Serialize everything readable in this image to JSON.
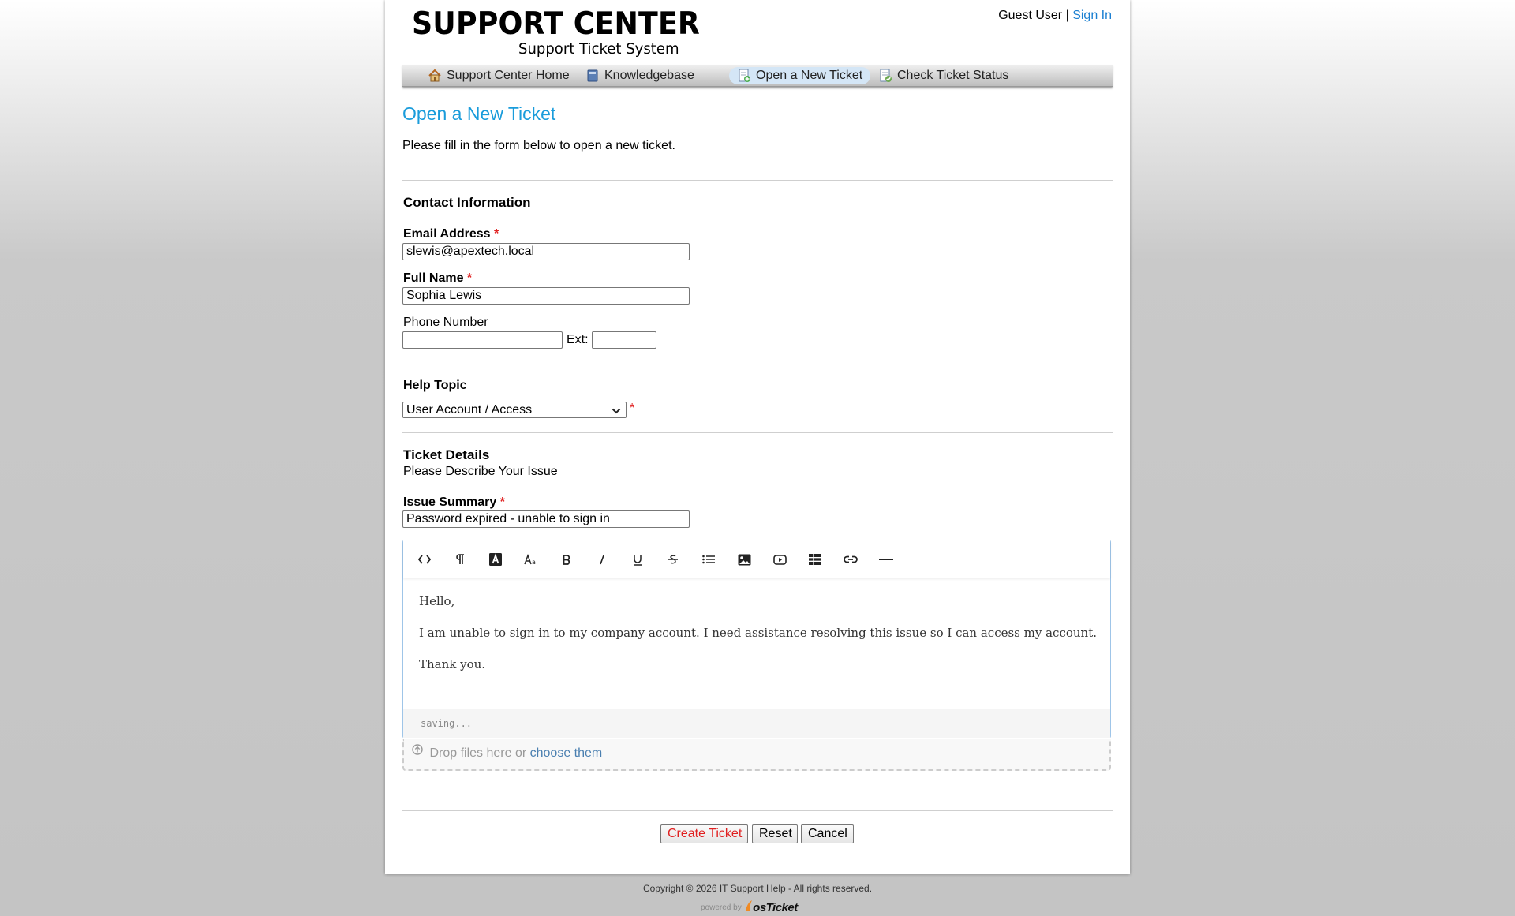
{
  "header": {
    "logo_title": "SUPPORT CENTER",
    "logo_subtitle": "Support Ticket System",
    "user_label": "Guest User",
    "separator": "|",
    "sign_in": "Sign In"
  },
  "nav": {
    "items": [
      {
        "label": "Support Center Home",
        "icon": "home-icon"
      },
      {
        "label": "Knowledgebase",
        "icon": "book-icon"
      },
      {
        "label": "Open a New Ticket",
        "icon": "new-ticket-icon",
        "active": true
      },
      {
        "label": "Check Ticket Status",
        "icon": "ticket-status-icon"
      }
    ]
  },
  "page": {
    "title": "Open a New Ticket",
    "intro": "Please fill in the form below to open a new ticket."
  },
  "contact": {
    "section_title": "Contact Information",
    "email_label": "Email Address",
    "email_value": "slewis@apextech.local",
    "name_label": "Full Name",
    "name_value": "Sophia Lewis",
    "phone_label": "Phone Number",
    "phone_value": "",
    "ext_label": "Ext:",
    "ext_value": "",
    "required_mark": "*"
  },
  "help_topic": {
    "section_title": "Help Topic",
    "selected": "User Account / Access",
    "required_mark": "*"
  },
  "details": {
    "section_title": "Ticket Details",
    "subtitle": "Please Describe Your Issue",
    "summary_label": "Issue Summary",
    "summary_value": "Password expired - unable to sign in",
    "required_mark": "*"
  },
  "editor": {
    "toolbar": [
      "html-icon",
      "paragraph-icon",
      "font-color-icon",
      "font-size-icon",
      "bold-icon",
      "italic-icon",
      "underline-icon",
      "strikethrough-icon",
      "list-icon",
      "image-icon",
      "video-icon",
      "table-icon",
      "link-icon",
      "horizontal-rule-icon"
    ],
    "lines": [
      "Hello,",
      "I am unable to sign in to my company account. I need assistance resolving this issue so I can access my account.",
      "Thank you."
    ],
    "status": "saving..."
  },
  "attachments": {
    "drop_text": "Drop files here or",
    "choose_link": "choose them"
  },
  "buttons": {
    "create": "Create Ticket",
    "reset": "Reset",
    "cancel": "Cancel"
  },
  "footer": {
    "copyright": "Copyright © 2026 IT Support Help - All rights reserved.",
    "powered_by": "powered by",
    "brand": "osTicket"
  },
  "colors": {
    "link": "#1a7fd1",
    "title": "#1a9cdb",
    "required": "#e02020"
  }
}
